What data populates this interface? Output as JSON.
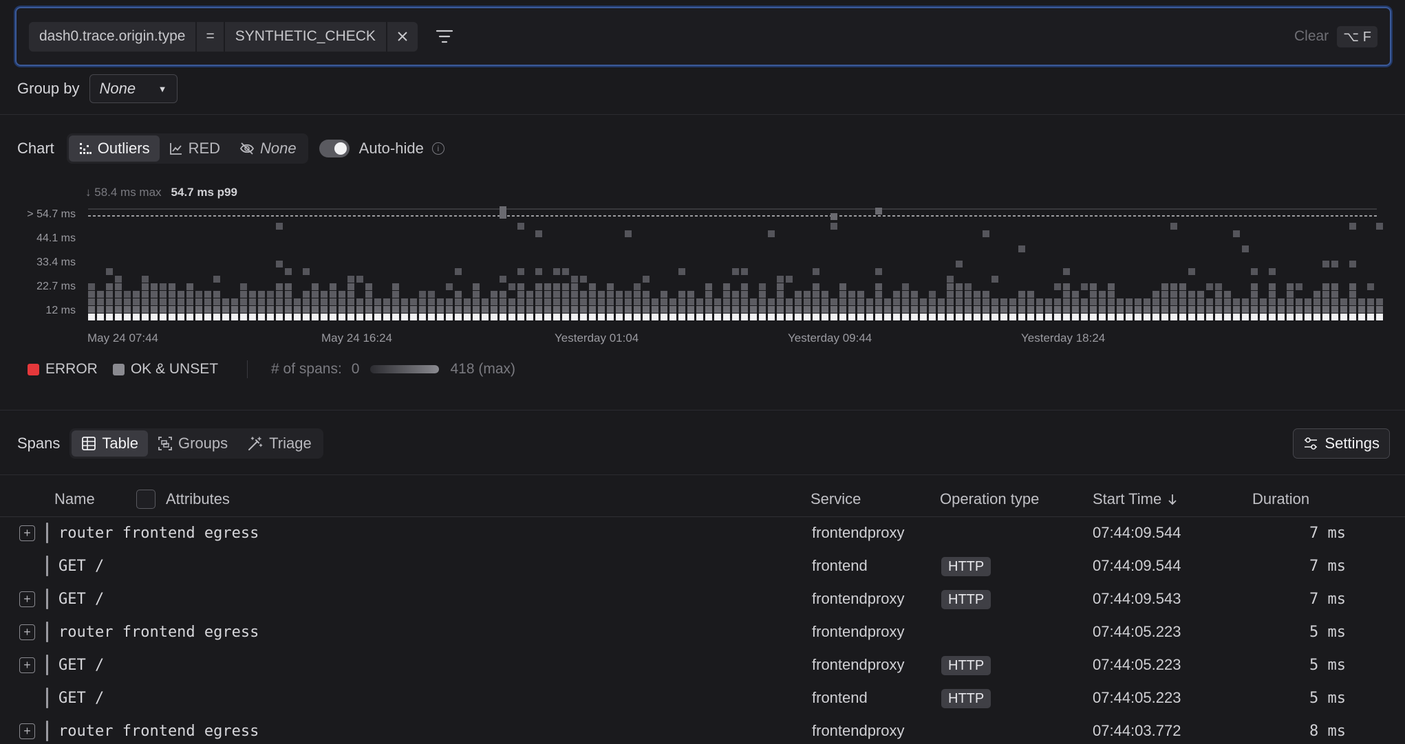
{
  "filter": {
    "key": "dash0.trace.origin.type",
    "operator": "=",
    "value": "SYNTHETIC_CHECK",
    "clear_label": "Clear",
    "shortcut": "⌥ F"
  },
  "group_by": {
    "label": "Group by",
    "value": "None"
  },
  "chart": {
    "label": "Chart",
    "modes": [
      "Outliers",
      "RED",
      "None"
    ],
    "active_mode": "Outliers",
    "autohide_label": "Auto-hide",
    "autohide_on": true,
    "max_label": "58.4 ms max",
    "p99_label": "54.7 ms p99"
  },
  "chart_data": {
    "type": "heatmap",
    "y_ticks": [
      "> 54.7 ms",
      "44.1 ms",
      "33.4 ms",
      "22.7 ms",
      "12 ms"
    ],
    "x_ticks": [
      "May 24 07:44",
      "May 24 16:24",
      "Yesterday 01:04",
      "Yesterday 09:44",
      "Yesterday 18:24"
    ],
    "threshold_ms": 54.7,
    "max_ms": 58.4,
    "legend": [
      {
        "name": "ERROR",
        "color": "#e5383b"
      },
      {
        "name": "OK & UNSET",
        "color": "#8a8a90"
      }
    ],
    "span_count_min": "0",
    "span_count_max": "418 (max)",
    "span_count_label": "# of spans:"
  },
  "spans": {
    "label": "Spans",
    "views": [
      "Table",
      "Groups",
      "Triage"
    ],
    "active_view": "Table",
    "settings_label": "Settings"
  },
  "table": {
    "columns": {
      "name": "Name",
      "attributes": "Attributes",
      "service": "Service",
      "operation": "Operation type",
      "start": "Start Time",
      "duration": "Duration"
    },
    "rows": [
      {
        "expandable": true,
        "name": "router frontend egress",
        "service": "frontendproxy",
        "op": "",
        "start": "07:44:09.544",
        "duration": "7 ms"
      },
      {
        "expandable": false,
        "name": "GET /",
        "service": "frontend",
        "op": "HTTP",
        "start": "07:44:09.544",
        "duration": "7 ms"
      },
      {
        "expandable": true,
        "name": "GET /",
        "service": "frontendproxy",
        "op": "HTTP",
        "start": "07:44:09.543",
        "duration": "7 ms"
      },
      {
        "expandable": true,
        "name": "router frontend egress",
        "service": "frontendproxy",
        "op": "",
        "start": "07:44:05.223",
        "duration": "5 ms"
      },
      {
        "expandable": true,
        "name": "GET /",
        "service": "frontendproxy",
        "op": "HTTP",
        "start": "07:44:05.223",
        "duration": "5 ms"
      },
      {
        "expandable": false,
        "name": "GET /",
        "service": "frontend",
        "op": "HTTP",
        "start": "07:44:05.223",
        "duration": "5 ms"
      },
      {
        "expandable": true,
        "name": "router frontend egress",
        "service": "frontendproxy",
        "op": "",
        "start": "07:44:03.772",
        "duration": "8 ms"
      }
    ]
  }
}
